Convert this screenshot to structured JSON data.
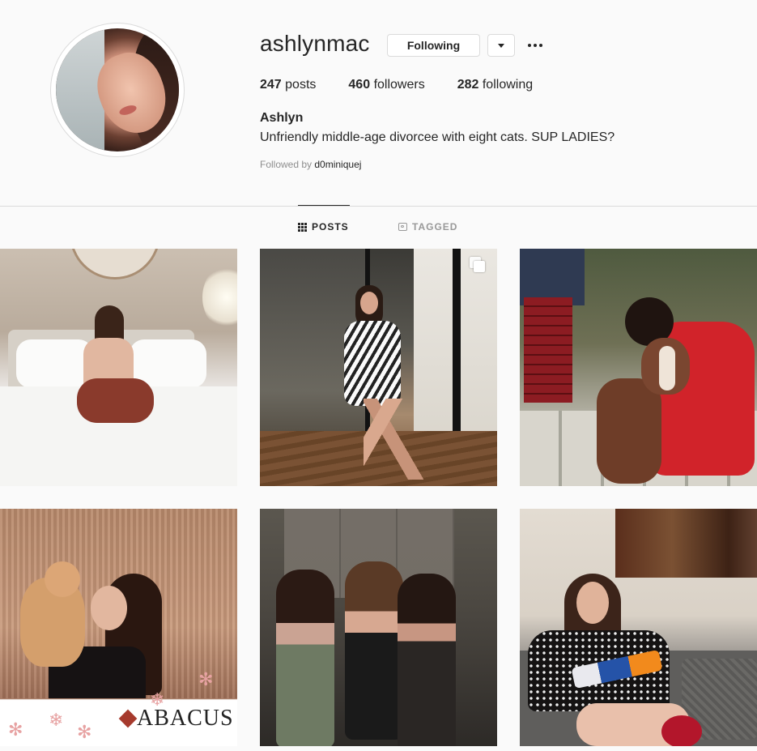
{
  "profile": {
    "username": "ashlynmac",
    "follow_label": "Following",
    "stats": {
      "posts_count": "247",
      "posts_label": "posts",
      "followers_count": "460",
      "followers_label": "followers",
      "following_count": "282",
      "following_label": "following"
    },
    "full_name": "Ashlyn",
    "bio": "Unfriendly middle-age divorcee with eight cats. SUP LADIES?",
    "followed_by_prefix": "Followed by",
    "followed_by_name": "d0miniquej"
  },
  "tabs": [
    {
      "label": "POSTS",
      "icon": "grid-icon",
      "active": true
    },
    {
      "label": "TAGGED",
      "icon": "tag-icon",
      "active": false
    }
  ],
  "posts": [
    {
      "description_icon": "photo"
    },
    {
      "description_icon": "carousel-icon"
    },
    {
      "description_icon": "photo"
    },
    {
      "description_icon": "photo",
      "overlay_text": "ABACUS"
    },
    {
      "description_icon": "photo"
    },
    {
      "description_icon": "photo"
    }
  ],
  "colors": {
    "background": "#fafafa",
    "text": "#262626",
    "muted": "#8e8e8e",
    "border": "#dbdbdb"
  }
}
